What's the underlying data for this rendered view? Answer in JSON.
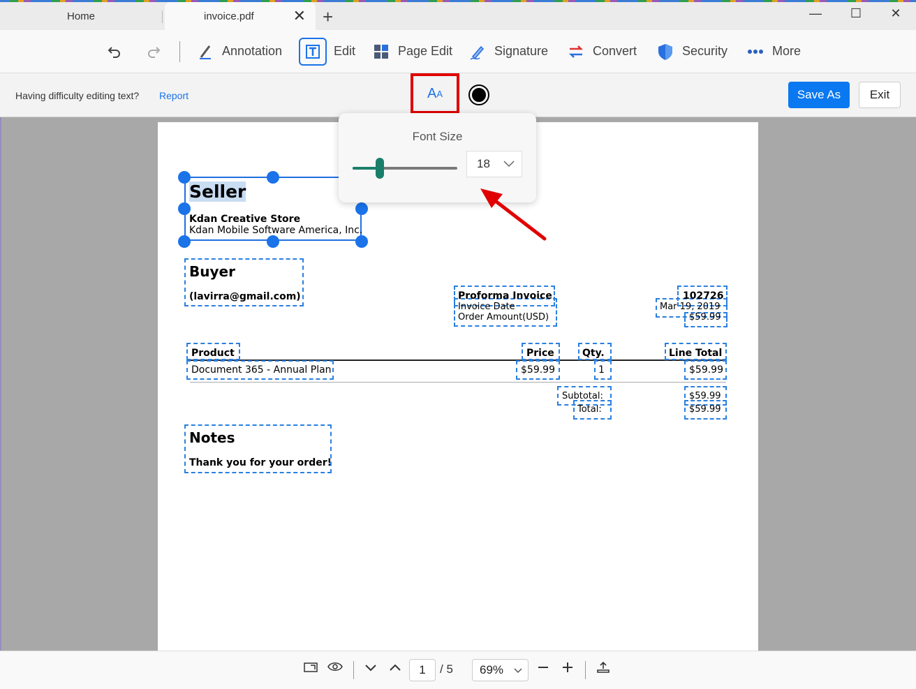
{
  "tabs": {
    "home": "Home",
    "active": "invoice.pdf",
    "new_tab": "+"
  },
  "window": {
    "minimize": "—",
    "maximize": "☐",
    "close": "✕"
  },
  "toolbar": {
    "undo_icon": "undo-icon",
    "redo_icon": "redo-icon",
    "annotation": "Annotation",
    "edit": "Edit",
    "page_edit": "Page Edit",
    "signature": "Signature",
    "convert": "Convert",
    "security": "Security",
    "more": "More"
  },
  "editbar": {
    "hint": "Having difficulty editing text?",
    "report": "Report",
    "font_button_large": "A",
    "font_button_small": "A",
    "save_as": "Save As",
    "exit": "Exit"
  },
  "font_popover": {
    "label": "Font Size",
    "value": "18",
    "slider_fraction": 0.2
  },
  "document": {
    "seller_heading": "Seller",
    "seller_name": "Kdan Creative Store",
    "seller_company": "Kdan Mobile Software America, Inc.",
    "buyer_heading": "Buyer",
    "buyer_email": "(lavirra@gmail.com)",
    "invoice_title": "Proforma Invoice",
    "invoice_date_label": "Invoice Date",
    "order_amount_label": "Order Amount(USD)",
    "invoice_number": "102726",
    "invoice_date": "Mar 19, 2019",
    "order_amount": "$59.99",
    "table_headers": {
      "product": "Product",
      "price": "Price",
      "qty": "Qty.",
      "line_total": "Line Total"
    },
    "row": {
      "product": "Document 365 - Annual Plan",
      "price": "$59.99",
      "qty": "1",
      "line_total": "$59.99"
    },
    "subtotal_label": "Subtotal:",
    "subtotal_value": "$59.99",
    "total_label": "Total:",
    "total_value": "$59.99",
    "notes_heading": "Notes",
    "notes_text": "Thank you for your order!"
  },
  "bottombar": {
    "page": "1",
    "page_total": "/ 5",
    "zoom": "69%"
  },
  "colors": {
    "accent": "#1a73e8",
    "highlight_red": "#e00000",
    "slider": "#1a7f6a"
  }
}
